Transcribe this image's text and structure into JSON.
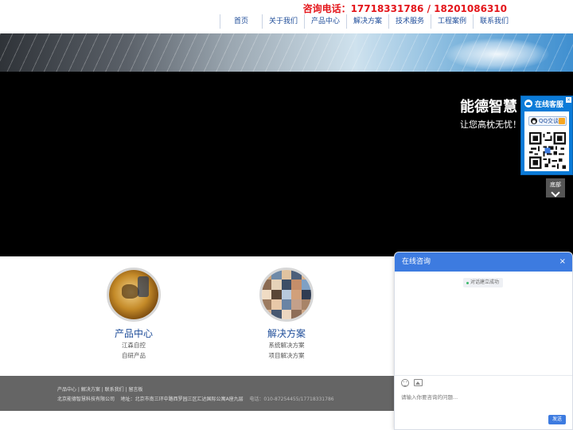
{
  "header": {
    "hotline": "咨询电话：17718331786 / 18201086310",
    "nav": [
      "首页",
      "关于我们",
      "产品中心",
      "解决方案",
      "技术服务",
      "工程案例",
      "联系我们"
    ]
  },
  "hero": {
    "title": "能德智慧",
    "subtitle": "让您高枕无忧！"
  },
  "service_widget": {
    "title": "在线客服",
    "close": "×",
    "qq_label": "QQ交谈",
    "to_bottom": "底部"
  },
  "products": [
    {
      "name": "产品中心",
      "items": [
        "江森自控",
        "自研产品"
      ]
    },
    {
      "name": "解决方案",
      "items": [
        "系统解决方案",
        "项目解决方案"
      ]
    }
  ],
  "footer": {
    "links": "产品中心 | 解决方案 | 联系我们 | 留言板",
    "company": "北京能德智慧科技有限公司",
    "address": "地址：北京市南三环中路西罗园三区汇达国际公寓A座九层",
    "phone": "电话：010-87254455/17718331786"
  },
  "chat": {
    "title": "在线咨询",
    "close": "×",
    "status_msg": "对话建立成功",
    "placeholder": "请输入你要咨询的问题...",
    "send_label": "发送",
    "accent_color": "#3d7be0"
  },
  "colors": {
    "hotline": "#e4161b",
    "nav_text": "#1f4d99",
    "footer_bg": "#656565"
  }
}
